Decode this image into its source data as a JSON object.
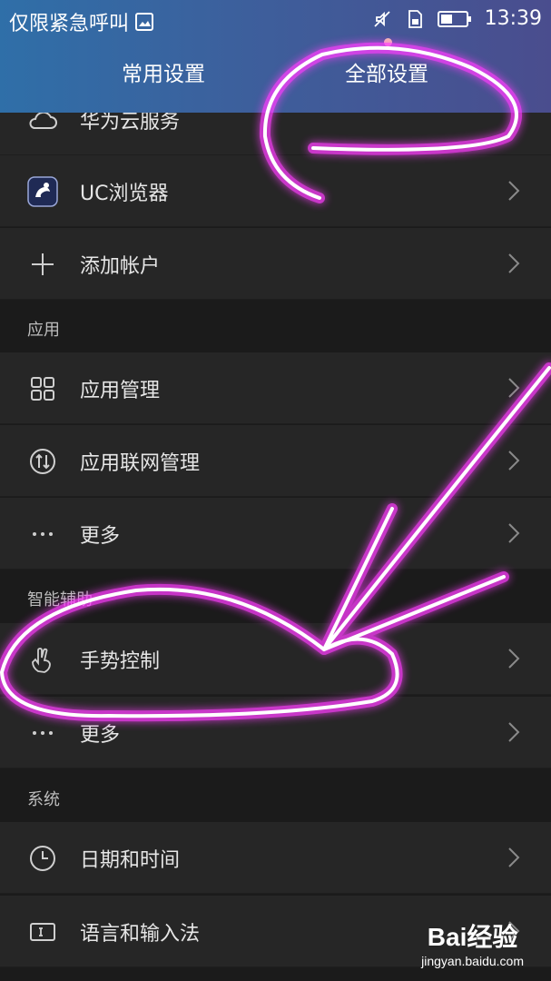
{
  "status_bar": {
    "left_text": "仅限紧急呼叫",
    "time": "13:39"
  },
  "tabs": [
    {
      "label": "常用设置"
    },
    {
      "label": "全部设置",
      "active": true
    }
  ],
  "rows_top": [
    {
      "label": "华为云服务",
      "icon": "cloud-icon"
    },
    {
      "label": "UC浏览器",
      "icon": "uc-browser-icon"
    },
    {
      "label": "添加帐户",
      "icon": "plus-icon"
    }
  ],
  "sections": [
    {
      "title": "应用",
      "items": [
        {
          "label": "应用管理",
          "icon": "grid-icon"
        },
        {
          "label": "应用联网管理",
          "icon": "network-icon"
        },
        {
          "label": "更多",
          "icon": "dots-icon"
        }
      ]
    },
    {
      "title": "智能辅助",
      "items": [
        {
          "label": "手势控制",
          "icon": "hand-gesture-icon"
        },
        {
          "label": "更多",
          "icon": "dots-icon"
        }
      ]
    },
    {
      "title": "系统",
      "items": [
        {
          "label": "日期和时间",
          "icon": "clock-icon"
        },
        {
          "label": "语言和输入法",
          "icon": "keyboard-icon"
        }
      ]
    }
  ],
  "watermark": {
    "logo": "Bai经验",
    "url": "jingyan.baidu.com"
  },
  "colors": {
    "accent_scribble": "#ff44ff",
    "header_start": "#2f6fa8",
    "header_end": "#4a4d8e"
  }
}
